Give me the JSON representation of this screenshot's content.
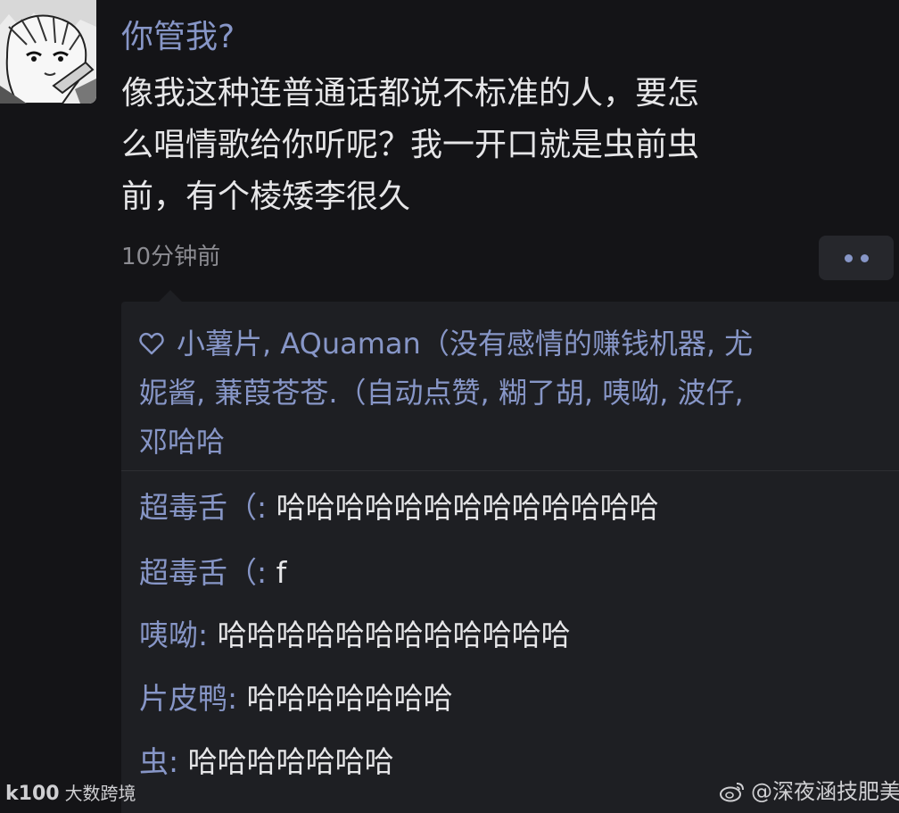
{
  "post": {
    "author": "你管我?",
    "text_lines": [
      "像我这种连普通话都说不标准的人，要怎",
      "么唱情歌给你听呢？我一开口就是虫前虫",
      "前，有个棱矮李很久"
    ],
    "timestamp": "10分钟前"
  },
  "likes": {
    "icon": "heart-outline-icon",
    "lines": [
      "小薯片, AQuaman（没有感情的赚钱机器, 尤",
      "妮酱, 蒹葭苍苍.（自动点赞, 糊了胡, 咦呦, 波仔,",
      "邓哈哈"
    ]
  },
  "comments": [
    {
      "name": "超毒舌（:",
      "content": " 哈哈哈哈哈哈哈哈哈哈哈哈哈"
    },
    {
      "name": "超毒舌（:",
      "content": " f"
    },
    {
      "name": "咦呦:",
      "content": " 哈哈哈哈哈哈哈哈哈哈哈哈"
    },
    {
      "name": "片皮鸭:",
      "content": " 哈哈哈哈哈哈哈"
    },
    {
      "name": "虫:",
      "content": " 哈哈哈哈哈哈哈"
    }
  ],
  "watermarks": {
    "left_logo": "k100",
    "left_text": "大数跨境",
    "right_text": "@深夜涵技肥美"
  },
  "colors": {
    "background": "#141417",
    "accent": "#8796c7",
    "text": "#e6e6e8",
    "panel": "#1e1f23"
  }
}
